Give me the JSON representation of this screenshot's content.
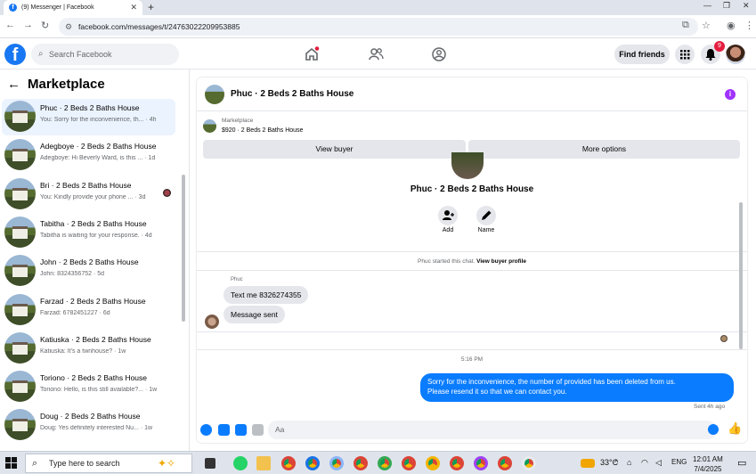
{
  "browser": {
    "tab_title": "(9) Messenger | Facebook",
    "tab_close": "✕",
    "new_tab": "+",
    "url": "facebook.com/messages/t/24763022209953885"
  },
  "header": {
    "search_placeholder": "Search Facebook",
    "find_friends": "Find friends",
    "notification_count": "9"
  },
  "sidebar": {
    "title": "Marketplace",
    "conversations": [
      {
        "title": "Phuc · 2 Beds 2 Baths House",
        "snippet": "You: Sorry for the inconvenience, th...",
        "time": "4h",
        "active": true
      },
      {
        "title": "Adegboye · 2 Beds 2 Baths House",
        "snippet": "Adegboye: Hi Beverly Ward, is this ...",
        "time": "1d"
      },
      {
        "title": "Bri · 2 Beds 2 Baths House",
        "snippet": "You: Kindly provide your phone ...",
        "time": "3d"
      },
      {
        "title": "Tabitha · 2 Beds 2 Baths House",
        "snippet": "Tabitha is waiting for your response.",
        "time": "4d"
      },
      {
        "title": "John · 2 Beds 2 Baths House",
        "snippet": "John: 8324356752",
        "time": "5d"
      },
      {
        "title": "Farzad · 2 Beds 2 Baths House",
        "snippet": "Farzad: 6782451227",
        "time": "6d"
      },
      {
        "title": "Katiuska · 2 Beds 2 Baths House",
        "snippet": "Katiuska: It's a twnhouse?",
        "time": "1w"
      },
      {
        "title": "Toriono · 2 Beds 2 Baths House",
        "snippet": "Toriono: Hello, is this still available?...",
        "time": "1w"
      },
      {
        "title": "Doug · 2 Beds 2 Baths House",
        "snippet": "Doug: Yes definitely interested Nu...",
        "time": "1w"
      }
    ]
  },
  "chat": {
    "header_name": "Phuc · 2 Beds 2 Baths House",
    "listing_label": "Marketplace",
    "listing_price": "$920 · 2 Beds 2 Baths House",
    "view_buyer": "View buyer",
    "more_options": "More options",
    "profile_name": "Phuc · 2 Beds 2 Baths House",
    "add_label": "Add",
    "name_label": "Name",
    "started_text": "Phuc started this chat.",
    "view_buyer_profile": "View buyer profile",
    "sender_label": "Phuc",
    "incoming": [
      "Text me 8326274355",
      "Message sent"
    ],
    "timestamp": "5:16 PM",
    "outgoing_line1": "Sorry for the inconvenience, the number of provided has been deleted from us.",
    "outgoing_line2": "Please resend it so that we can contact you.",
    "sent_label": "Sent 4h ago",
    "composer_placeholder": "Aa"
  },
  "taskbar": {
    "search_placeholder": "Type here to search",
    "weather": "33°C",
    "lang": "ENG",
    "time": "12:01 AM",
    "date": "7/4/2025"
  }
}
